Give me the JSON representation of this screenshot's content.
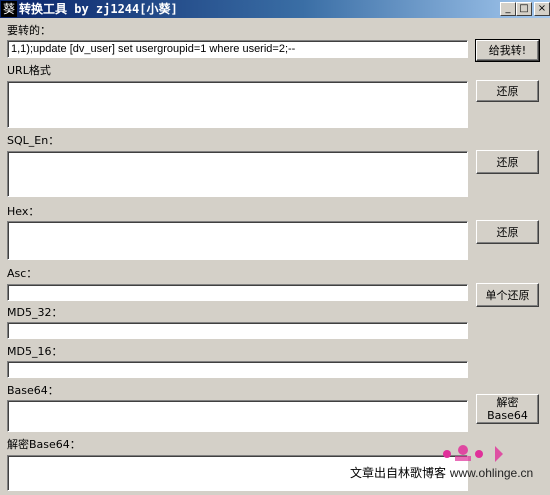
{
  "window": {
    "title": "转换工具 by zj1244[小葵]",
    "icon": "葵",
    "controls": {
      "minimize": "_",
      "maximize": "□",
      "close": "×"
    }
  },
  "fields": {
    "input": {
      "label": "要转的：",
      "value": "1,1);update [dv_user] set usergroupid=1 where userid=2;--"
    },
    "url": {
      "label": "URL格式",
      "value": ""
    },
    "sql_en": {
      "label": "SQL_En：",
      "value": ""
    },
    "hex": {
      "label": "Hex：",
      "value": ""
    },
    "asc": {
      "label": "Asc：",
      "value": ""
    },
    "md5_32": {
      "label": "MD5_32：",
      "value": ""
    },
    "md5_16": {
      "label": "MD5_16：",
      "value": ""
    },
    "base64": {
      "label": "Base64：",
      "value": ""
    },
    "decode_base64": {
      "label": "解密Base64：",
      "value": ""
    }
  },
  "buttons": {
    "convert": "给我转!",
    "restore_url": "还原",
    "restore_sql": "还原",
    "restore_hex": "还原",
    "restore_single": "单个还原",
    "decrypt_line1": "解密",
    "decrypt_line2": "Base64"
  },
  "watermark": {
    "text": "文章出自林歌博客",
    "site": "www.ohlinge.cn"
  },
  "colors": {
    "window_bg": "#d4d0c8",
    "titlebar_start": "#0a246a",
    "titlebar_end": "#a6caf0",
    "watermark_accent": "#e0309a"
  }
}
